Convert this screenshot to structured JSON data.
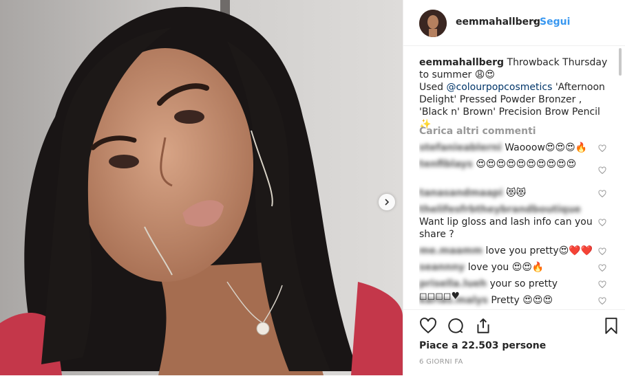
{
  "post": {
    "username": "eemmahallberg",
    "dot": "•",
    "follow_label": "Segui"
  },
  "caption": {
    "username": "eemmahallberg",
    "line1": " Throwback Thursday to summer 😩😍",
    "used": "Used ",
    "mention": "@colourpopcosmetics",
    "rest": " 'Afternoon Delight' Pressed Powder Bronzer , 'Black n' Brown' Precision Brow Pencil ✨"
  },
  "load_more_label": "Carica altri commenti",
  "comments": [
    {
      "user": "stefanieablerni",
      "text": "Waooow😍😍😍🔥"
    },
    {
      "user": "tenfiblays",
      "text": "😍😍😍😍😍😍😍😍😍😍"
    },
    {
      "user": "tanasandmaapi",
      "text": "😻😻"
    },
    {
      "user": "thelifesfrbtheybrandboutique",
      "text": "Want lip gloss and lash info can you share ?"
    },
    {
      "user": "me.maamm",
      "text": "love you pretty😍❤️❤️"
    },
    {
      "user": "seannny",
      "text": "love you 😍😍🔥"
    },
    {
      "user": "prisella.lueh",
      "text": "your so pretty ◻◻◻◻♥"
    },
    {
      "user": "karlas.malys",
      "text": "Pretty 😍😍😍"
    }
  ],
  "likes_text": "Piace a 22.503 persone",
  "time_text": "6 GIORNI FA",
  "icons": {
    "like": "heart-icon",
    "comment": "comment-icon",
    "share": "share-icon",
    "save": "bookmark-icon",
    "next": "chevron-right-icon"
  }
}
